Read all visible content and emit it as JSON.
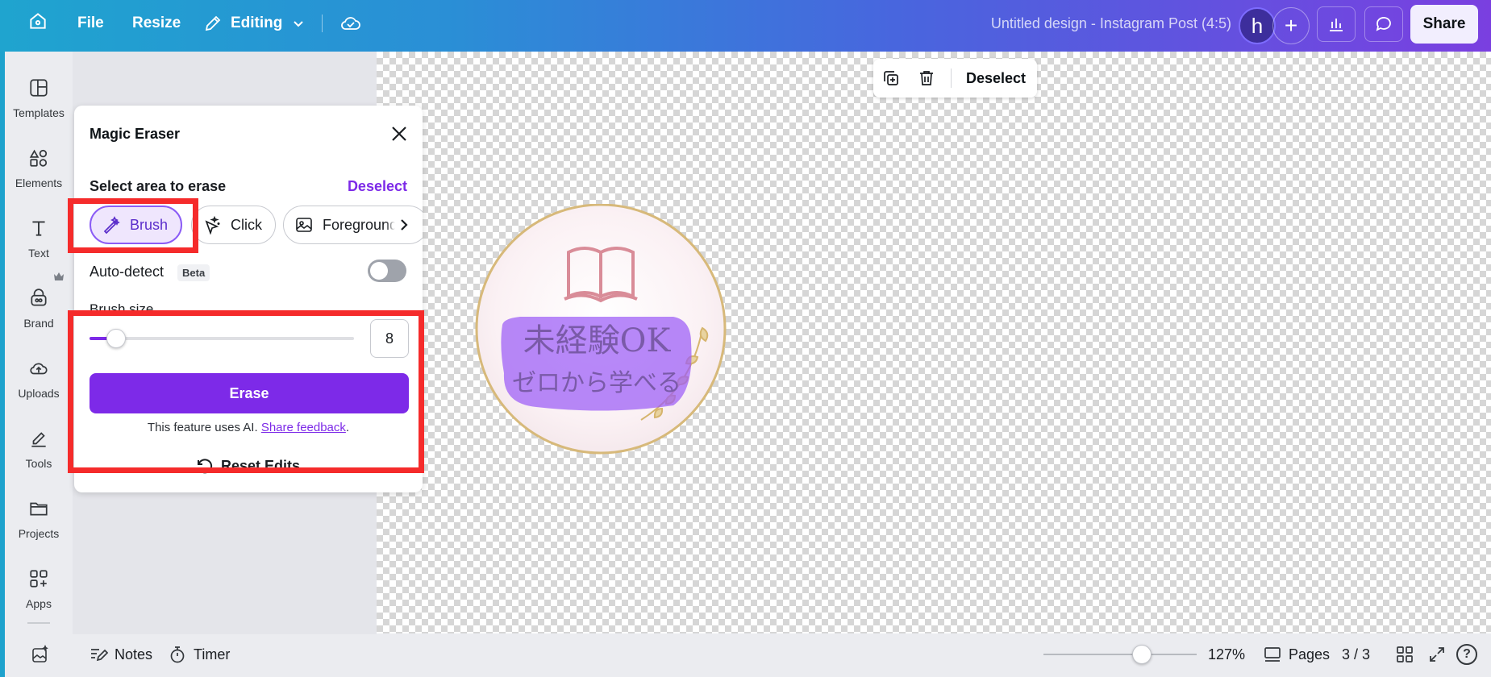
{
  "topbar": {
    "file": "File",
    "resize": "Resize",
    "editing": "Editing",
    "title": "Untitled design - Instagram Post (4:5)",
    "avatar_letter": "h",
    "plus": "+",
    "share": "Share"
  },
  "rail": {
    "items": [
      {
        "label": "Templates",
        "icon": "templates-icon"
      },
      {
        "label": "Elements",
        "icon": "elements-icon"
      },
      {
        "label": "Text",
        "icon": "text-icon"
      },
      {
        "label": "Brand",
        "icon": "brand-icon"
      },
      {
        "label": "Uploads",
        "icon": "uploads-icon"
      },
      {
        "label": "Tools",
        "icon": "tools-icon"
      },
      {
        "label": "Projects",
        "icon": "projects-icon"
      },
      {
        "label": "Apps",
        "icon": "apps-icon"
      }
    ]
  },
  "context_toolbar": {
    "deselect": "Deselect"
  },
  "design": {
    "line1": "未経験OK",
    "line2": "ゼロから学べる"
  },
  "panel": {
    "title": "Magic Eraser",
    "select_label": "Select area to erase",
    "deselect": "Deselect",
    "modes": [
      "Brush",
      "Click",
      "Foreground"
    ],
    "active_mode": "Brush",
    "auto_detect": "Auto-detect",
    "beta": "Beta",
    "auto_detect_on": false,
    "brush_size_label": "Brush size",
    "brush_size": "8",
    "erase": "Erase",
    "ai_note": "This feature uses AI.",
    "feedback_link": "Share feedback",
    "period": ".",
    "reset": "Reset Edits"
  },
  "bottombar": {
    "notes": "Notes",
    "timer": "Timer",
    "zoom": "127%",
    "pages": "Pages",
    "page_count": "3 / 3",
    "help": "?"
  },
  "colors": {
    "accent": "#7d2ae8",
    "annotation": "#f52b2b"
  }
}
